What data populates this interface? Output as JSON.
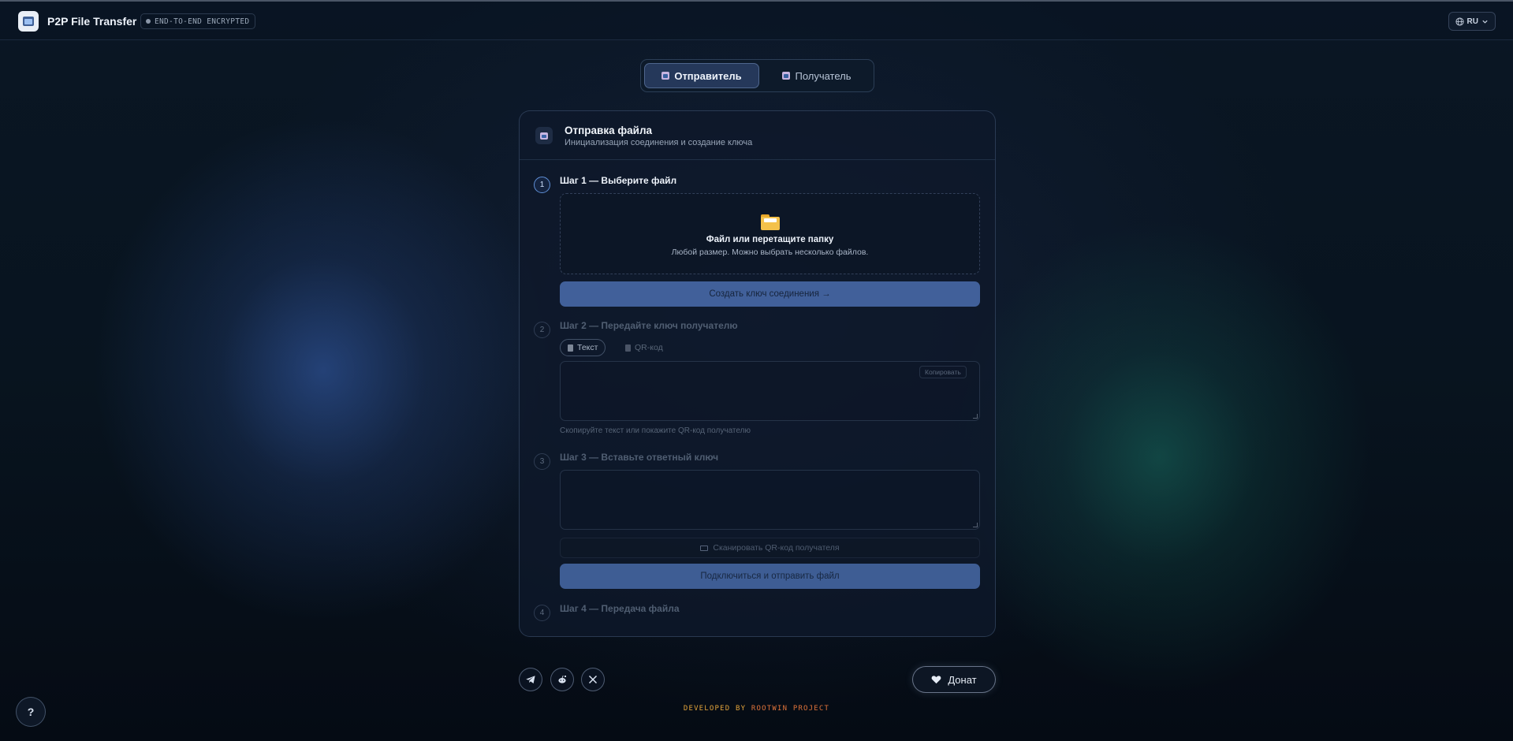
{
  "app": {
    "title": "P2P File Transfer",
    "badge": "END-TO-END ENCRYPTED",
    "language": "RU"
  },
  "role_tabs": [
    {
      "label": "Отправитель",
      "active": true
    },
    {
      "label": "Получатель",
      "active": false
    }
  ],
  "card": {
    "title": "Отправка файла",
    "subtitle": "Инициализация соединения и создание ключа"
  },
  "step1": {
    "number": "1",
    "title": "Шаг 1 — Выберите файл",
    "dropzone_title": "Файл или перетащите папку",
    "dropzone_sub": "Любой размер. Можно выбрать несколько файлов.",
    "button": "Создать ключ соединения →"
  },
  "step2": {
    "number": "2",
    "title": "Шаг 2 — Передайте ключ получателю",
    "tab_text": "Текст",
    "tab_qr": "QR-код",
    "copy_button": "Копировать",
    "key_value": "",
    "hint": "Скопируйте текст или покажите QR-код получателю"
  },
  "step3": {
    "number": "3",
    "title": "Шаг 3 — Вставьте ответный ключ",
    "answer_value": "",
    "scan_button": "Сканировать QR-код получателя",
    "button": "Подключиться и отправить файл"
  },
  "step4": {
    "number": "4",
    "title": "Шаг 4 — Передача файла"
  },
  "footer": {
    "donate": "Донат",
    "credit_prefix": "DEVELOPED BY",
    "credit_name": "ROOTWIN PROJECT",
    "help": "?"
  },
  "colors": {
    "accent": "#41609a",
    "active_step": "#5f8fd6",
    "credit_prefix": "#e0a23b",
    "credit_name": "#e0733a"
  },
  "icons": {
    "logo": "folder-window-icon",
    "language": "globe-icon",
    "dropzone": "folder-icon",
    "social": [
      "telegram-icon",
      "reddit-icon",
      "x-icon"
    ],
    "donate": "heart-icon"
  }
}
